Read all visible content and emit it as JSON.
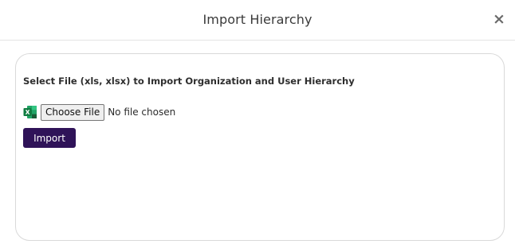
{
  "header": {
    "title": "Import Hierarchy",
    "close_label": "×"
  },
  "form": {
    "instruction": "Select File (xls, xlsx) to Import Organization and User Hierarchy",
    "file_icon": "excel-icon",
    "choose_file_label": "Choose File",
    "file_status": "No file chosen",
    "import_label": "Import"
  },
  "colors": {
    "primary_button": "#2f1358",
    "excel_green": "#1d6f42"
  }
}
